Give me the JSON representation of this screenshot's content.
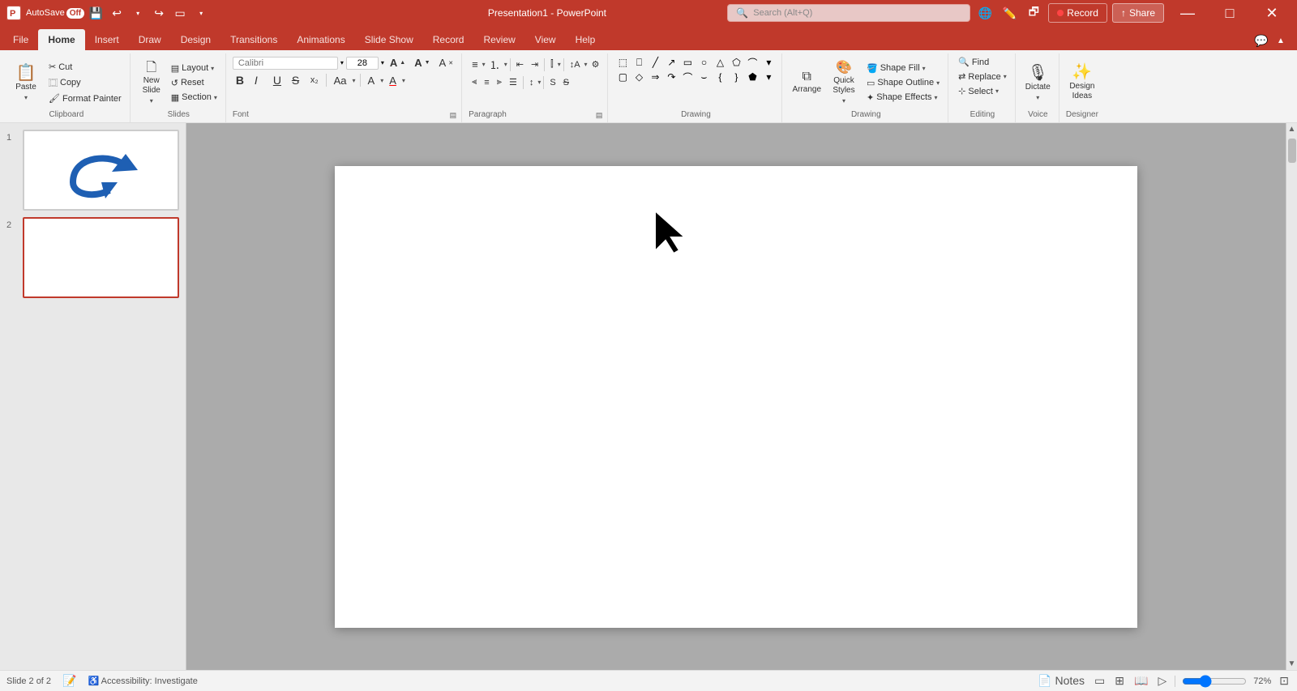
{
  "app": {
    "title": "Presentation1 - PowerPoint",
    "autosave_label": "AutoSave",
    "autosave_state": "Off",
    "search_placeholder": "Search (Alt+Q)"
  },
  "title_bar": {
    "record_label": "Record",
    "share_label": "Share"
  },
  "tabs": [
    {
      "id": "file",
      "label": "File"
    },
    {
      "id": "home",
      "label": "Home",
      "active": true
    },
    {
      "id": "insert",
      "label": "Insert"
    },
    {
      "id": "draw",
      "label": "Draw"
    },
    {
      "id": "design",
      "label": "Design"
    },
    {
      "id": "transitions",
      "label": "Transitions"
    },
    {
      "id": "animations",
      "label": "Animations"
    },
    {
      "id": "slideshow",
      "label": "Slide Show"
    },
    {
      "id": "record",
      "label": "Record"
    },
    {
      "id": "review",
      "label": "Review"
    },
    {
      "id": "view",
      "label": "View"
    },
    {
      "id": "help",
      "label": "Help"
    }
  ],
  "ribbon": {
    "clipboard": {
      "label": "Clipboard",
      "paste": "Paste",
      "cut": "Cut",
      "copy": "Copy",
      "format_painter": "Format Painter"
    },
    "slides": {
      "label": "Slides",
      "new_slide": "New\nSlide",
      "layout": "Layout",
      "reset": "Reset",
      "section": "Section"
    },
    "font": {
      "label": "Font",
      "font_name": "",
      "font_size": "28",
      "bold": "B",
      "italic": "I",
      "underline": "U",
      "strikethrough": "S",
      "increase": "A↑",
      "decrease": "A↓",
      "clear": "A"
    },
    "paragraph": {
      "label": "Paragraph"
    },
    "drawing": {
      "label": "Drawing",
      "arrange": "Arrange",
      "quick_styles": "Quick\nStyles",
      "shape_fill": "Shape Fill",
      "shape_outline": "Shape Outline",
      "shape_effects": "Shape Effects"
    },
    "editing": {
      "label": "Editing",
      "find": "Find",
      "replace": "Replace",
      "select": "Select"
    },
    "voice": {
      "label": "Voice",
      "dictate": "Dictate"
    },
    "designer": {
      "label": "Designer",
      "design_ideas": "Design\nIdeas"
    }
  },
  "slides": [
    {
      "number": "1",
      "has_arrow": true
    },
    {
      "number": "2",
      "has_arrow": false,
      "active": true
    }
  ],
  "status_bar": {
    "slide_count": "Slide 2 of 2",
    "accessibility": "Accessibility: Investigate",
    "notes": "Notes",
    "zoom": "72%",
    "zoom_value": 72
  }
}
